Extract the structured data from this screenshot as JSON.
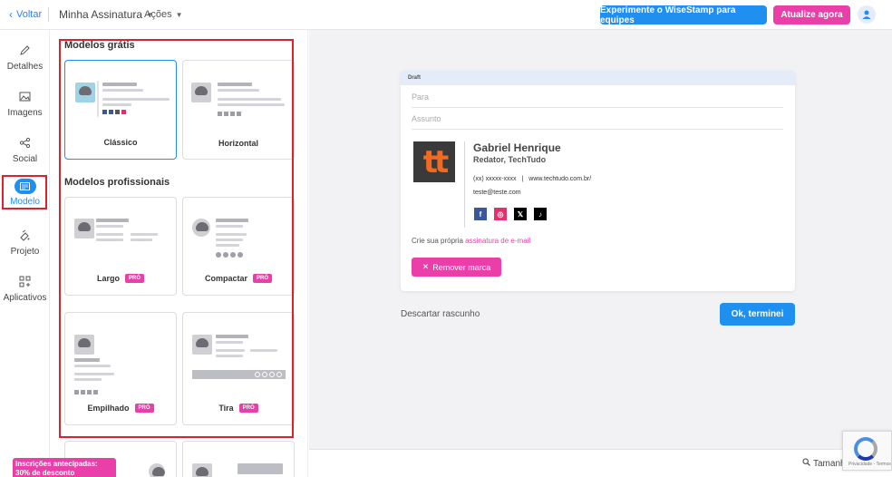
{
  "topbar": {
    "back_label": "Voltar",
    "signature_menu": "Minha Assinatura",
    "actions_menu": "Ações",
    "teams_button": "Experimente o WiseStamp para equipes",
    "upgrade_button": "Atualize agora",
    "colors": {
      "primary": "#1f8ff0",
      "accent": "#ea3fa8"
    }
  },
  "sidebar": {
    "items": [
      {
        "label": "Detalhes",
        "icon": "pencil-icon"
      },
      {
        "label": "Imagens",
        "icon": "image-icon"
      },
      {
        "label": "Social",
        "icon": "share-icon"
      },
      {
        "label": "Modelo",
        "icon": "template-icon",
        "active": true
      },
      {
        "label": "Projeto",
        "icon": "palette-icon"
      },
      {
        "label": "Aplicativos",
        "icon": "apps-icon"
      }
    ]
  },
  "templates": {
    "free_title": "Modelos grátis",
    "pro_title": "Modelos profissionais",
    "pro_badge": "PRÓ",
    "free": [
      {
        "name": "Clássico",
        "selected": true
      },
      {
        "name": "Horizontal"
      }
    ],
    "pro": [
      {
        "name": "Largo"
      },
      {
        "name": "Compactar"
      },
      {
        "name": "Empilhado"
      },
      {
        "name": "Tira"
      }
    ]
  },
  "promo": {
    "text": "Inscrições antecipadas: 30% de desconto"
  },
  "email": {
    "draft_label": "Draft",
    "to_placeholder": "Para",
    "subject_placeholder": "Assunto",
    "signature": {
      "logo_text": "tt",
      "name": "Gabriel Henrique",
      "role": "Redator,  TechTudo",
      "phone": "(xx) xxxxx-xxxx",
      "divider": "|",
      "website": "www.techtudo.com.br/",
      "email": "teste@teste.com",
      "social": [
        {
          "icon": "facebook-icon",
          "glyph": "f",
          "color": "#3b5998"
        },
        {
          "icon": "instagram-icon",
          "glyph": "◎",
          "color": "#e1306c"
        },
        {
          "icon": "x-icon",
          "glyph": "𝕏",
          "color": "#000000"
        },
        {
          "icon": "tiktok-icon",
          "glyph": "♪",
          "color": "#000000"
        }
      ]
    },
    "create_text": "Crie sua própria",
    "create_link": "assinatura de e-mail",
    "remove_brand": "Remover marca"
  },
  "actions": {
    "discard": "Descartar rascunho",
    "done": "Ok, terminei"
  },
  "bottom": {
    "size_label": "Tamanh"
  },
  "recaptcha": {
    "text": "Privacidade - Termos"
  }
}
